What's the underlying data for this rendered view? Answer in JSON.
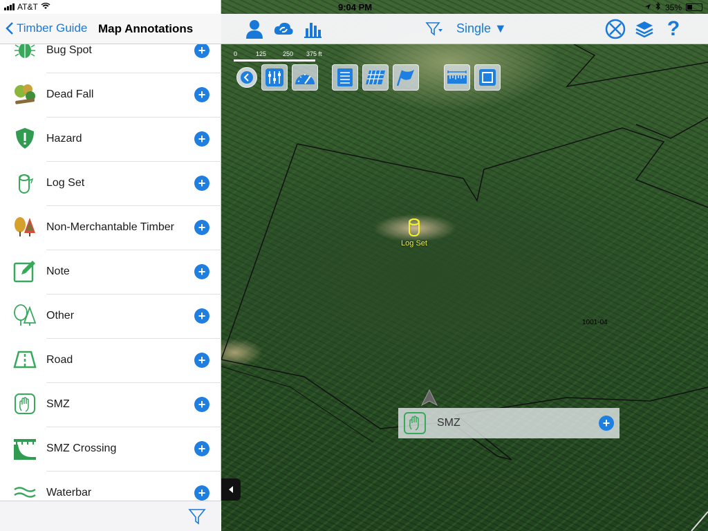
{
  "status_bar": {
    "carrier": "AT&T",
    "time": "9:04 PM",
    "battery_text": "35%",
    "battery_level": 0.35
  },
  "panel": {
    "back_label": "Timber Guide",
    "title": "Map Annotations",
    "items": [
      {
        "label": "Bug Spot",
        "icon": "bug-icon"
      },
      {
        "label": "Dead Fall",
        "icon": "dead-fall-icon"
      },
      {
        "label": "Hazard",
        "icon": "hazard-shield-icon"
      },
      {
        "label": "Log Set",
        "icon": "log-icon"
      },
      {
        "label": "Non-Merchantable Timber",
        "icon": "trees-icon"
      },
      {
        "label": "Note",
        "icon": "note-edit-icon"
      },
      {
        "label": "Other",
        "icon": "other-trees-icon"
      },
      {
        "label": "Road",
        "icon": "road-icon"
      },
      {
        "label": "SMZ",
        "icon": "hand-icon"
      },
      {
        "label": "SMZ Crossing",
        "icon": "bridge-icon"
      },
      {
        "label": "Waterbar",
        "icon": "water-icon"
      }
    ]
  },
  "toolbar": {
    "mode_label": "Single ▼",
    "left_icons": [
      "user-icon",
      "sync-icon",
      "bar-chart-icon"
    ],
    "center_icon": "filter-icon",
    "right_icons": [
      "compass-icon",
      "layers-icon",
      "help-icon"
    ]
  },
  "scale": {
    "ticks": [
      "0",
      "125",
      "250",
      "375 ft"
    ]
  },
  "map": {
    "annotation_label": "Log Set",
    "stand_label": "1001-04",
    "callout_label": "SMZ"
  },
  "colors": {
    "accent": "#1879d8",
    "add_button": "#1f7fe0",
    "icon_green": "#38a85d",
    "annotation_yellow": "#f4f230"
  }
}
